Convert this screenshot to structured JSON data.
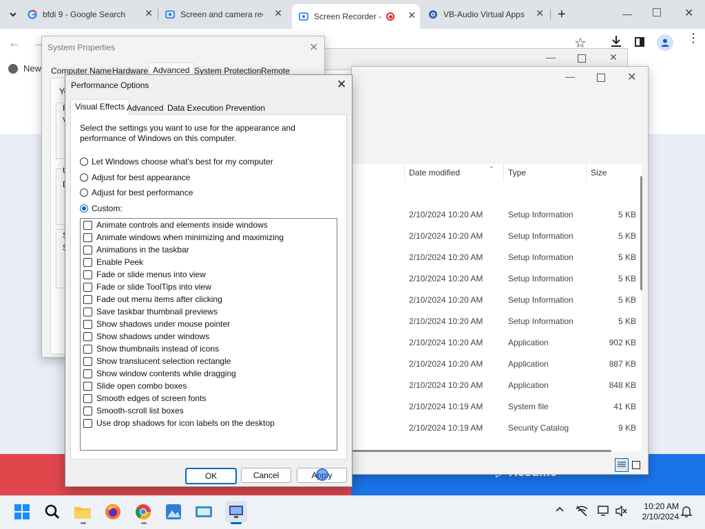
{
  "browser": {
    "tabs": [
      {
        "title": "bfdi 9 - Google Search",
        "icon": "google-icon"
      },
      {
        "title": "Screen and camera rec",
        "icon": "screen-recorder-icon"
      },
      {
        "title": "Screen Recorder -",
        "icon": "screen-recorder-icon",
        "active": true
      },
      {
        "title": "VB-Audio Virtual Apps",
        "icon": "vb-audio-icon"
      }
    ],
    "bookmark_label": "New"
  },
  "page": {
    "resume_label": "Resume"
  },
  "system_properties": {
    "title": "System Properties",
    "tabs": [
      "Computer Name",
      "Hardware",
      "Advanced",
      "System Protection",
      "Remote"
    ],
    "active_tab": "Advanced",
    "fragments": [
      "Yo",
      "P",
      "V",
      "U",
      "D",
      "S",
      "S"
    ]
  },
  "performance_options": {
    "title": "Performance Options",
    "tabs": [
      "Visual Effects",
      "Advanced",
      "Data Execution Prevention"
    ],
    "active_tab": "Visual Effects",
    "description": "Select the settings you want to use for the appearance and performance of Windows on this computer.",
    "description_line1": "Select the settings you want to use for the appearance and",
    "description_line2": "performance of Windows on this computer.",
    "radios": [
      {
        "label": "Let Windows choose what's best for my computer",
        "selected": false
      },
      {
        "label": "Adjust for best appearance",
        "selected": false
      },
      {
        "label": "Adjust for best performance",
        "selected": false
      },
      {
        "label": "Custom:",
        "selected": true
      }
    ],
    "effects": [
      "Animate controls and elements inside windows",
      "Animate windows when minimizing and maximizing",
      "Animations in the taskbar",
      "Enable Peek",
      "Fade or slide menus into view",
      "Fade or slide ToolTips into view",
      "Fade out menu items after clicking",
      "Save taskbar thumbnail previews",
      "Show shadows under mouse pointer",
      "Show shadows under windows",
      "Show thumbnails instead of icons",
      "Show translucent selection rectangle",
      "Show window contents while dragging",
      "Slide open combo boxes",
      "Smooth edges of screen fonts",
      "Smooth-scroll list boxes",
      "Use drop shadows for icon labels on the desktop"
    ],
    "buttons": {
      "ok": "OK",
      "cancel": "Cancel",
      "apply": "Apply"
    }
  },
  "explorer": {
    "columns": [
      "Date modified",
      "Type",
      "Size"
    ],
    "rows": [
      {
        "date": "2/10/2024 10:20 AM",
        "type": "Setup Information",
        "size": "5 KB"
      },
      {
        "date": "2/10/2024 10:20 AM",
        "type": "Setup Information",
        "size": "5 KB"
      },
      {
        "date": "2/10/2024 10:20 AM",
        "type": "Setup Information",
        "size": "5 KB"
      },
      {
        "date": "2/10/2024 10:20 AM",
        "type": "Setup Information",
        "size": "5 KB"
      },
      {
        "date": "2/10/2024 10:20 AM",
        "type": "Setup Information",
        "size": "5 KB"
      },
      {
        "date": "2/10/2024 10:20 AM",
        "type": "Setup Information",
        "size": "5 KB"
      },
      {
        "date": "2/10/2024 10:20 AM",
        "type": "Application",
        "size": "902 KB"
      },
      {
        "date": "2/10/2024 10:20 AM",
        "type": "Application",
        "size": "887 KB"
      },
      {
        "date": "2/10/2024 10:20 AM",
        "type": "Application",
        "size": "848 KB"
      },
      {
        "date": "2/10/2024 10:19 AM",
        "type": "System file",
        "size": "41 KB"
      },
      {
        "date": "2/10/2024 10:19 AM",
        "type": "Security Catalog",
        "size": "9 KB"
      }
    ]
  },
  "taskbar": {
    "time": "10:20 AM",
    "date": "2/10/2024",
    "apps": [
      "start-icon",
      "search-icon",
      "file-explorer-icon",
      "firefox-icon",
      "chrome-icon",
      "photos-icon",
      "keyboard-app-icon",
      "remote-desktop-icon"
    ]
  },
  "colors": {
    "accent": "#0067c0",
    "red_bar": "#e2464d",
    "blue_bar": "#1a73e8"
  }
}
